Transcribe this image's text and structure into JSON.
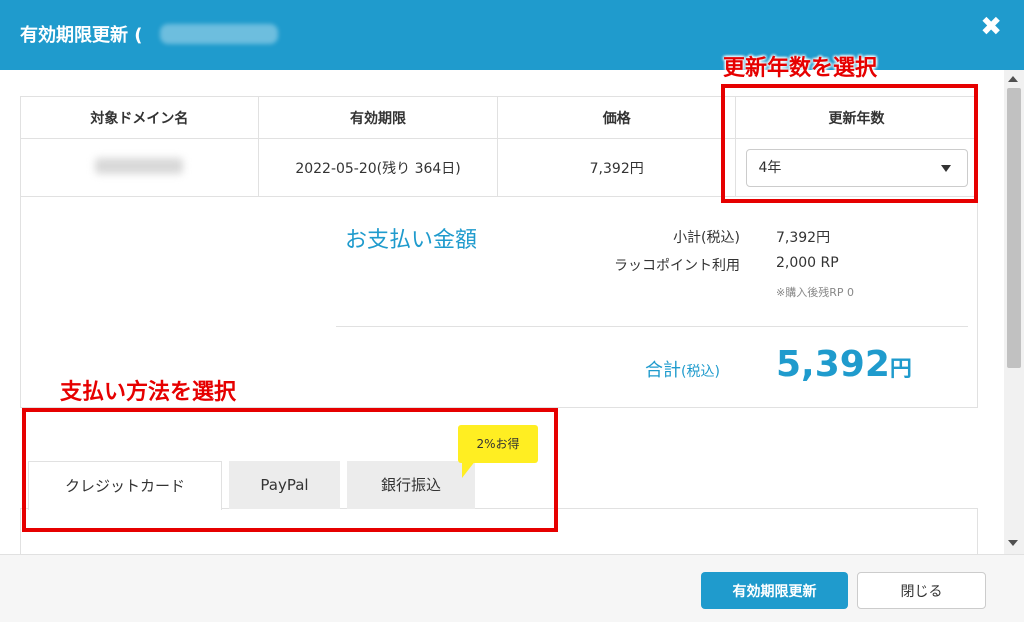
{
  "header": {
    "title": "有効期限更新",
    "title_paren": "("
  },
  "table": {
    "headers": [
      "対象ドメイン名",
      "有効期限",
      "価格",
      "更新年数"
    ],
    "row": {
      "expiry": "2022-05-20(残り 364日)",
      "price": "7,392円",
      "years_selected": "4年"
    }
  },
  "summary": {
    "title": "お支払い金額",
    "subtotal_label": "小計(税込)",
    "subtotal_value": "7,392円",
    "points_label": "ラッコポイント利用",
    "points_value": "2,000 RP",
    "note": "※購入後残RP 0",
    "total_label": "合計",
    "total_tax": "(税込)",
    "total_value": "5,392",
    "total_unit": "円"
  },
  "tabs": [
    {
      "label": "クレジットカード"
    },
    {
      "label": "PayPal"
    },
    {
      "label": "銀行振込"
    }
  ],
  "badge": "2%お得",
  "annotations": {
    "years": "更新年数を選択",
    "payment": "支払い方法を選択"
  },
  "footer": {
    "update_label": "有効期限更新",
    "close_label": "閉じる"
  },
  "colors": {
    "brand": "#1f9bcd",
    "annotation": "#e60000",
    "badge": "#ffee22"
  }
}
